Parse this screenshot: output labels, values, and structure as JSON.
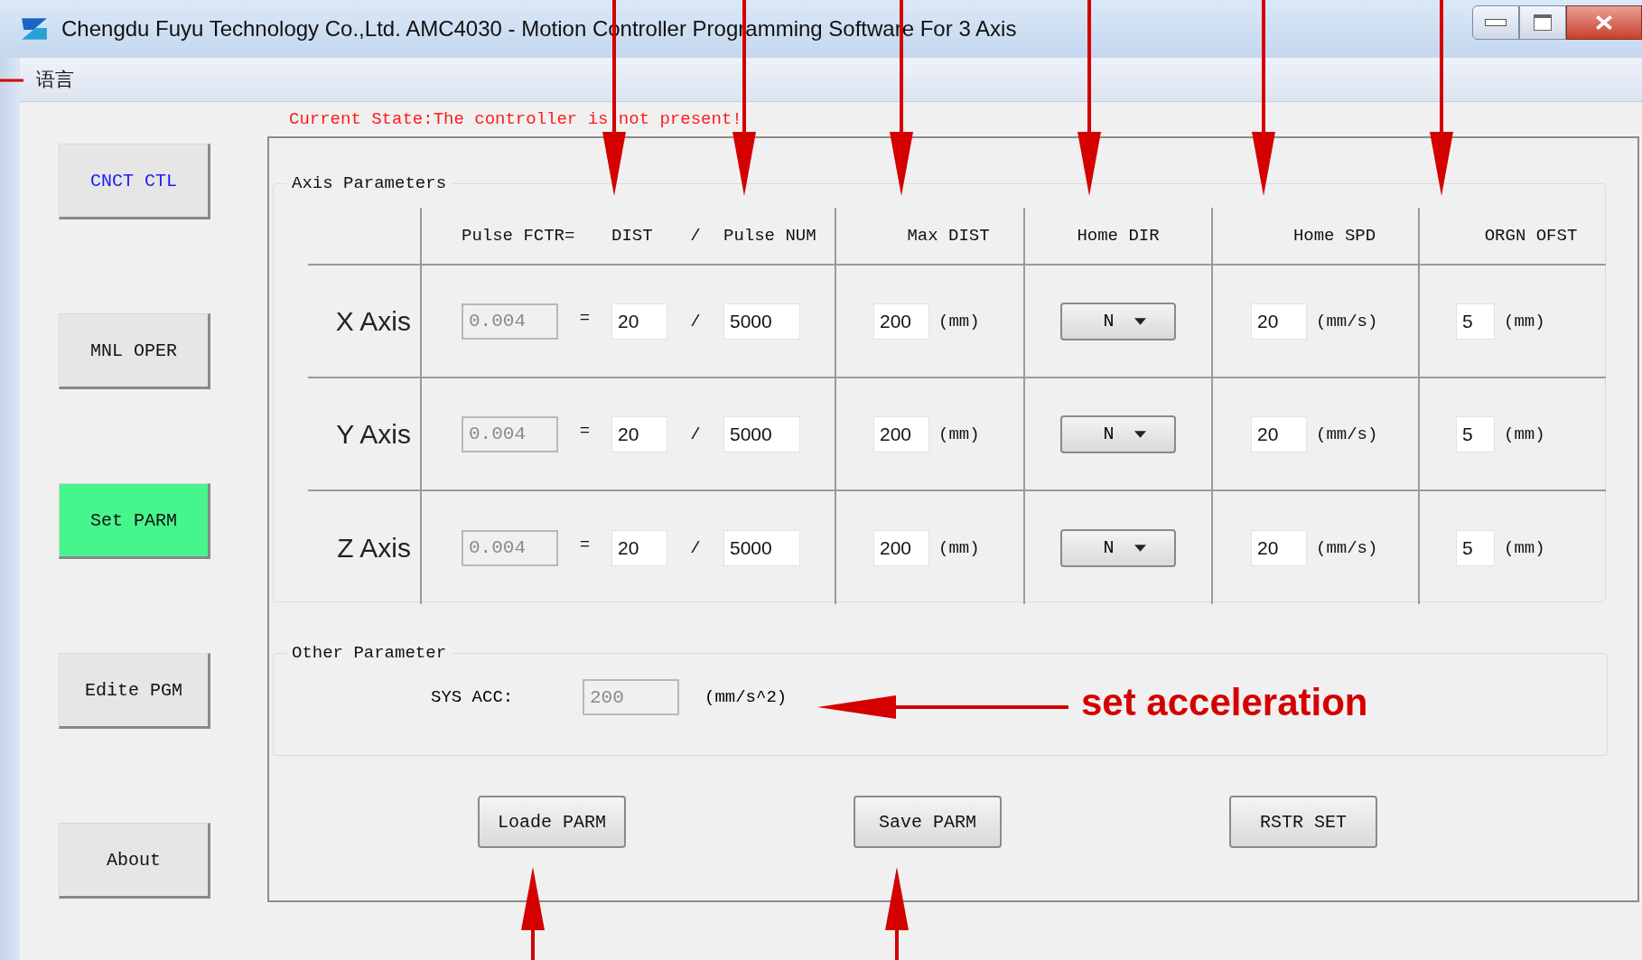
{
  "window": {
    "title": "Chengdu Fuyu Technology Co.,Ltd.  AMC4030 -  Motion Controller Programming Software For 3 Axis"
  },
  "menu": [
    "语言"
  ],
  "nav": [
    {
      "label": "CNCT CTL",
      "kind": "connect",
      "selected": false
    },
    {
      "label": "MNL OPER",
      "kind": "page",
      "selected": false
    },
    {
      "label": "Set PARM",
      "kind": "page",
      "selected": true
    },
    {
      "label": "Edite PGM",
      "kind": "page",
      "selected": false
    },
    {
      "label": "About",
      "kind": "page",
      "selected": false
    }
  ],
  "status": "Current State:The controller is not present!",
  "axis_parameters": {
    "legend": "Axis Parameters",
    "headers": {
      "factor": "Pulse FCTR=",
      "dist": "DIST",
      "slash": "/",
      "pulse_num": "Pulse NUM",
      "max_dist": "Max DIST",
      "home_dir": "Home DIR",
      "home_spd": "Home SPD",
      "orgn_ofst": "ORGN OFST"
    },
    "rows": [
      {
        "axis": "X Axis",
        "pulse_factor": {
          "value": "0.004",
          "disabled": true
        },
        "equals": "=",
        "dist": "20",
        "slash": "/",
        "pulse_num": "5000",
        "max_dist": "200",
        "max_dist_unit": "(mm)",
        "home_dir": "N",
        "home_spd": "20",
        "home_spd_unit": "(mm/s)",
        "orgn_ofst": "5",
        "orgn_ofst_unit": "(mm)"
      },
      {
        "axis": "Y Axis",
        "pulse_factor": {
          "value": "0.004",
          "disabled": true
        },
        "equals": "=",
        "dist": "20",
        "slash": "/",
        "pulse_num": "5000",
        "max_dist": "200",
        "max_dist_unit": "(mm)",
        "home_dir": "N",
        "home_spd": "20",
        "home_spd_unit": "(mm/s)",
        "orgn_ofst": "5",
        "orgn_ofst_unit": "(mm)"
      },
      {
        "axis": "Z Axis",
        "pulse_factor": {
          "value": "0.004",
          "disabled": true
        },
        "equals": "=",
        "dist": "20",
        "slash": "/",
        "pulse_num": "5000",
        "max_dist": "200",
        "max_dist_unit": "(mm)",
        "home_dir": "N",
        "home_spd": "20",
        "home_spd_unit": "(mm/s)",
        "orgn_ofst": "5",
        "orgn_ofst_unit": "(mm)"
      }
    ]
  },
  "other_parameter": {
    "legend": "Other Parameter",
    "label": "SYS ACC:",
    "sys_acc": {
      "value": "200",
      "disabled": true
    },
    "unit": "(mm/s^2)"
  },
  "buttons": [
    "Loade PARM",
    "Save PARM",
    "RSTR SET"
  ],
  "annotation": {
    "callout": "set acceleration"
  }
}
